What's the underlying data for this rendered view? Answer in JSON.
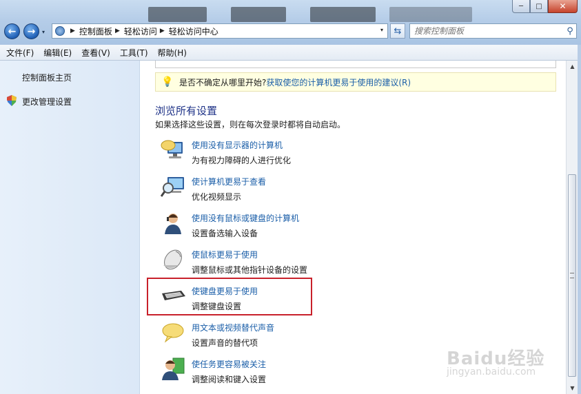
{
  "window": {
    "minimize_glyph": "─",
    "maximize_glyph": "□",
    "close_glyph": "✕"
  },
  "nav": {
    "back_glyph": "←",
    "forward_glyph": "→",
    "history_glyph": "▾",
    "breadcrumbs": [
      "控制面板",
      "轻松访问",
      "轻松访问中心"
    ],
    "address_dropdown_glyph": "▾",
    "refresh_glyph": "⇆"
  },
  "search": {
    "placeholder": "搜索控制面板"
  },
  "menubar": {
    "items": [
      "文件(F)",
      "编辑(E)",
      "查看(V)",
      "工具(T)",
      "帮助(H)"
    ]
  },
  "left_pane": {
    "home_link": "控制面板主页",
    "admin_link": "更改管理设置"
  },
  "tip": {
    "text": "是否不确定从哪里开始?",
    "link": "获取使您的计算机更易于使用的建议(R)"
  },
  "section": {
    "title": "浏览所有设置",
    "subtitle": "如果选择这些设置，则在每次登录时都将自动启动。"
  },
  "settings": [
    {
      "link": "使用没有显示器的计算机",
      "desc": "为有视力障碍的人进行优化",
      "icon": "speech-monitor-icon"
    },
    {
      "link": "使计算机更易于查看",
      "desc": "优化视频显示",
      "icon": "magnifier-monitor-icon"
    },
    {
      "link": "使用没有鼠标或键盘的计算机",
      "desc": "设置备选输入设备",
      "icon": "user-headset-icon"
    },
    {
      "link": "使鼠标更易于使用",
      "desc": "调整鼠标或其他指针设备的设置",
      "icon": "mouse-icon"
    },
    {
      "link": "使键盘更易于使用",
      "desc": "调整键盘设置",
      "icon": "keyboard-icon"
    },
    {
      "link": "用文本或视频替代声音",
      "desc": "设置声音的替代项",
      "icon": "speech-bubble-icon"
    },
    {
      "link": "使任务更容易被关注",
      "desc": "调整阅读和键入设置",
      "icon": "user-window-icon"
    }
  ],
  "watermark": {
    "brand": "Baidu经验",
    "site": "jingyan.baidu.com"
  },
  "colors": {
    "link": "#1a5ea8",
    "title": "#1e3287",
    "highlight": "#c8202a",
    "tip_bg": "#ffffe1"
  }
}
